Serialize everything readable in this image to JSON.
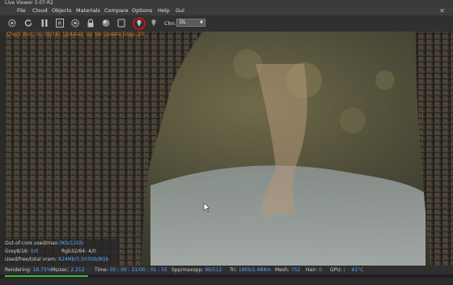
{
  "window": {
    "title": "Live Viewer 3.07-R2"
  },
  "menu": {
    "items": [
      "File",
      "Cloud",
      "Objects",
      "Materials",
      "Compare",
      "Options",
      "Help",
      "Gui"
    ]
  },
  "toolbar": {
    "icons": [
      "gear-icon",
      "restart-icon",
      "pause-icon",
      "region-icon",
      "settings-icon",
      "lock-icon",
      "sphere-icon",
      "clay-icon",
      "focus-picker-icon",
      "white-balance-picker-icon"
    ],
    "channel_label": "Chn:",
    "channel_value": "DL"
  },
  "viewport": {
    "status_text": "Check Rvn: Ini: 0b/16c Updates: Up Yes Update Grap- 20",
    "highlight_color": "#e01010"
  },
  "info_panel": {
    "out_of_core_label": "Out-of-core used/max:",
    "out_of_core_value": "0Kb/12Gb",
    "grey_label": "Grey8/16:",
    "grey_value": "0/0",
    "rgb_label": "Rgb32/64:",
    "rgb_value": "4/0",
    "vram_label": "Used/free/total vram:",
    "vram_value": "824Mb/5.503Gb/8Gb"
  },
  "stats": {
    "rendering_label": "Rendering:",
    "rendering_value": "18.75%",
    "ms_label": "Ms/sec:",
    "ms_value": "2.212",
    "time_label": "Time:",
    "time_value": "00 : 00 : 21/00 : 01 : 55",
    "spp_label": "Spp/maxspp:",
    "spp_value": "96/512",
    "tri_label": "Tri:",
    "tri_value": "180k/1.484m",
    "mesh_label": "Mesh:",
    "mesh_value": "752",
    "hair_label": "Hair:",
    "hair_value": "0",
    "gpu_label": "GPU:",
    "gpu_value": "61°C",
    "progress": 0.1875
  },
  "colors": {
    "accent_blue": "#5aa7ff",
    "progress_green": "#3fbf3f",
    "status_orange": "#ff8c1a"
  }
}
